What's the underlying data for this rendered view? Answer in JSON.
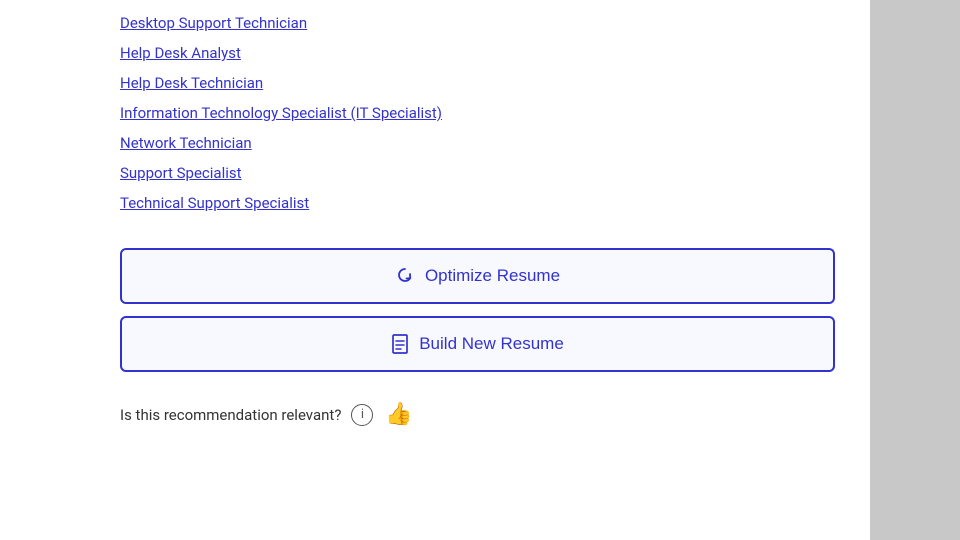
{
  "jobLinks": [
    {
      "label": "Desktop Support Technician"
    },
    {
      "label": "Help Desk Analyst"
    },
    {
      "label": "Help Desk Technician"
    },
    {
      "label": "Information Technology Specialist (IT Specialist)"
    },
    {
      "label": "Network Technician"
    },
    {
      "label": "Support Specialist"
    },
    {
      "label": "Technical Support Specialist"
    }
  ],
  "buttons": {
    "optimizeResume": {
      "label": "Optimize Resume",
      "icon": "↻"
    },
    "buildNewResume": {
      "label": "Build New Resume",
      "icon": "☰"
    }
  },
  "recommendation": {
    "question": "Is this recommendation relevant?"
  }
}
